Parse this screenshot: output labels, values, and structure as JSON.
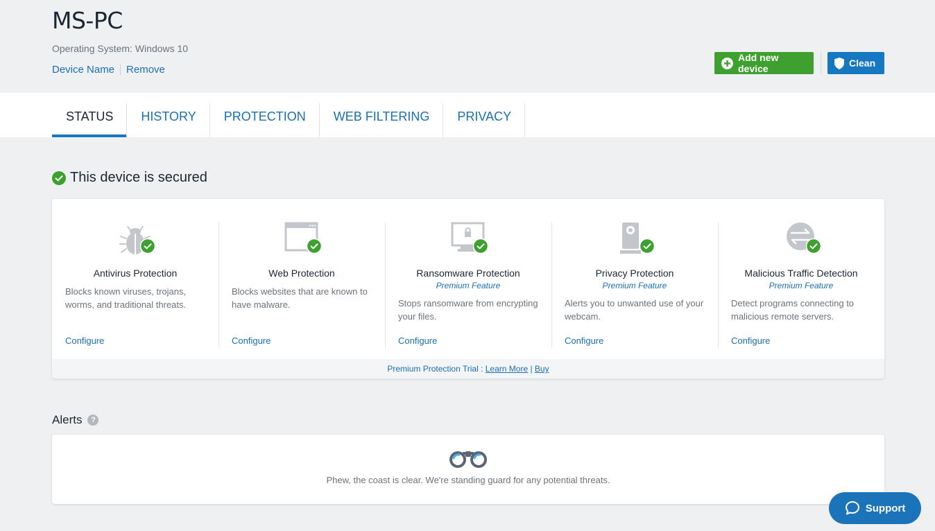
{
  "header": {
    "title": "MS-PC",
    "os_label": "Operating System: Windows 10",
    "device_name_link": "Device Name",
    "remove_link": "Remove",
    "add_device_label": "Add new device",
    "clean_label": "Clean"
  },
  "tabs": [
    {
      "label": "STATUS",
      "active": true
    },
    {
      "label": "HISTORY",
      "active": false
    },
    {
      "label": "PROTECTION",
      "active": false
    },
    {
      "label": "WEB FILTERING",
      "active": false
    },
    {
      "label": "PRIVACY",
      "active": false
    }
  ],
  "status": {
    "heading": "This device is secured"
  },
  "features": [
    {
      "icon": "bug-icon",
      "title": "Antivirus Protection",
      "premium": "",
      "description": "Blocks known viruses, trojans, worms, and traditional threats.",
      "configure": "Configure"
    },
    {
      "icon": "browser-window-icon",
      "title": "Web Protection",
      "premium": "",
      "description": "Blocks websites that are known to have malware.",
      "configure": "Configure"
    },
    {
      "icon": "monitor-lock-icon",
      "title": "Ransomware Protection",
      "premium": "Premium Feature",
      "description": "Stops ransomware from encrypting your files.",
      "configure": "Configure"
    },
    {
      "icon": "webcam-icon",
      "title": "Privacy Protection",
      "premium": "Premium Feature",
      "description": "Alerts you to unwanted use of your webcam.",
      "configure": "Configure"
    },
    {
      "icon": "traffic-arrows-icon",
      "title": "Malicious Traffic Detection",
      "premium": "Premium Feature",
      "description": "Detect programs connecting to malicious remote servers.",
      "configure": "Configure"
    }
  ],
  "trial": {
    "text": "Premium Protection Trial : ",
    "learn_more": "Learn More",
    "separator": " | ",
    "buy": "Buy"
  },
  "alerts": {
    "heading": "Alerts",
    "help": "?",
    "empty_message": "Phew, the coast is clear. We're standing guard for any potential threats."
  },
  "support": {
    "label": "Support"
  },
  "colors": {
    "accent": "#1778c2",
    "success": "#3ea02f",
    "link": "#1a6fb4",
    "background": "#eff0f2"
  }
}
